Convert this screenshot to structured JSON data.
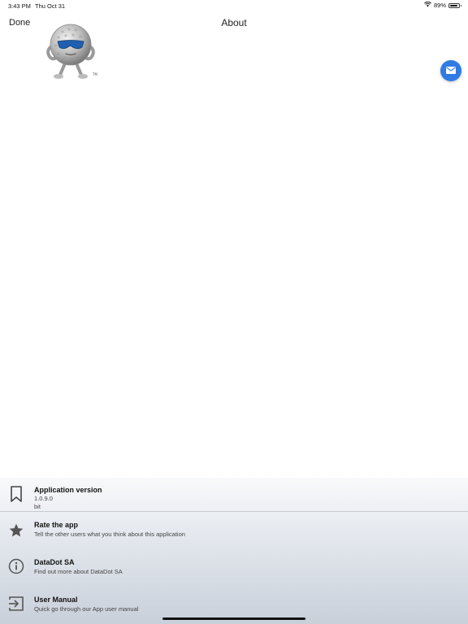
{
  "status_bar": {
    "time": "3:43 PM",
    "date": "Thu Oct 31",
    "battery": "89%",
    "battery_level": 0.89
  },
  "nav": {
    "done_label": "Done",
    "title": "About"
  },
  "icons": {
    "mascot": "golf-ball-mascot-image",
    "mail": "mail-icon",
    "bookmark": "bookmark-icon",
    "star": "star-icon",
    "info": "info-icon",
    "manual": "exit-arrow-icon"
  },
  "colors": {
    "accent": "#2f7be3",
    "panel_bottom": "#c9d0da"
  },
  "list": {
    "version": {
      "title": "Application version",
      "value": "1.0.9.0",
      "extra": "bit"
    },
    "rate": {
      "title": "Rate the app",
      "subtitle": "Tell the other users what you think about this application"
    },
    "company": {
      "title": "DataDot SA",
      "subtitle": "Find out more about DataDot SA"
    },
    "manual": {
      "title": "User Manual",
      "subtitle": "Quick go through our App user manual"
    }
  }
}
